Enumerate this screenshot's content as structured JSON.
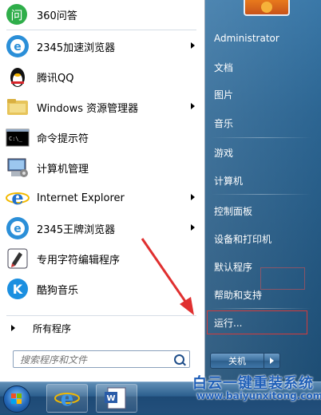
{
  "programs": [
    {
      "label": "360问答",
      "icon": "360-wenda-icon",
      "submenu": false
    },
    {
      "label": "2345加速浏览器",
      "icon": "2345-browser-icon",
      "submenu": true
    },
    {
      "label": "腾讯QQ",
      "icon": "qq-penguin-icon",
      "submenu": false
    },
    {
      "label": "Windows 资源管理器",
      "icon": "explorer-folder-icon",
      "submenu": true
    },
    {
      "label": "命令提示符",
      "icon": "cmd-prompt-icon",
      "submenu": false
    },
    {
      "label": "计算机管理",
      "icon": "computer-management-icon",
      "submenu": false
    },
    {
      "label": "Internet Explorer",
      "icon": "internet-explorer-icon",
      "submenu": true
    },
    {
      "label": "2345王牌浏览器",
      "icon": "2345-browser-icon",
      "submenu": true
    },
    {
      "label": "专用字符编辑程序",
      "icon": "char-editor-icon",
      "submenu": false
    },
    {
      "label": "酷狗音乐",
      "icon": "kugou-music-icon",
      "submenu": false
    }
  ],
  "all_programs": "所有程序",
  "search": {
    "placeholder": "搜索程序和文件"
  },
  "right_panel": {
    "user": "Administrator",
    "items": [
      "文档",
      "图片",
      "音乐",
      "游戏",
      "计算机",
      "控制面板",
      "设备和打印机",
      "默认程序",
      "帮助和支持",
      "运行..."
    ]
  },
  "shutdown": {
    "label": "关机"
  },
  "watermark": {
    "line1": "白云一键重装系统",
    "line2": "www.baiyunxitong.com"
  },
  "colors": {
    "highlight_box": "#d33b3b",
    "arrow": "#e03030",
    "right_panel": "#2c6592"
  }
}
